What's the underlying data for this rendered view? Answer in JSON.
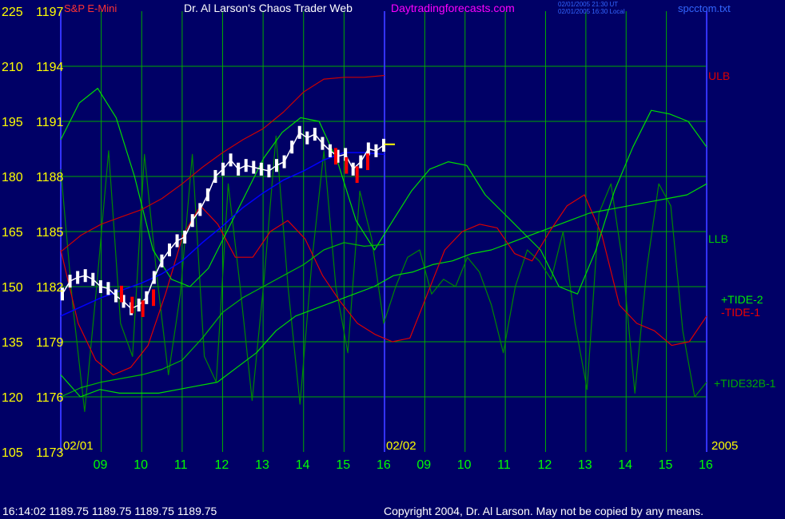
{
  "header": {
    "instrument": "S&P E-Mini",
    "title": "Dr. Al Larson's Chaos Trader Web",
    "site": "Daytradingforecasts.com",
    "stamp_line1": "02/01/2005 21:30 UT",
    "stamp_line2": "02/01/2005 16:30 Local",
    "filename": "spcctom.txt"
  },
  "footer": {
    "quote": "16:14:02  1189.75 1189.75 1189.75 1189.75",
    "copyright": "Copyright 2004, Dr. Al Larson. May not be copied by any means."
  },
  "colors": {
    "background": "#000066",
    "grid": "#00aa00",
    "axis_label": "#ffff00",
    "hour_label": "#00ff00",
    "price_bars": "#ffffff",
    "price_bars_red": "#ff0000",
    "divider": "#3333ff",
    "ulb": "#cc0000",
    "llb": "#00bb00",
    "tide2": "#00dd00",
    "tide1": "#dd0000",
    "tide32": "#008800",
    "moving_avg": "#0000ff",
    "forecast_tick": "#ffff00"
  },
  "chart_data": {
    "type": "line",
    "y_left_outer": {
      "labels": [
        "225",
        "210",
        "195",
        "180",
        "165",
        "150",
        "135",
        "120",
        "105"
      ],
      "range": [
        105,
        225
      ]
    },
    "y_left_inner": {
      "labels": [
        "1197",
        "1194",
        "1191",
        "1188",
        "1185",
        "1182",
        "1179",
        "1176",
        "1173"
      ],
      "range": [
        1173,
        1197
      ]
    },
    "x_hours": [
      "09",
      "10",
      "11",
      "12",
      "13",
      "14",
      "15",
      "16",
      "09",
      "10",
      "11",
      "12",
      "13",
      "14",
      "15",
      "16"
    ],
    "date_labels": [
      "02/01",
      "02/02"
    ],
    "year_label": "2005",
    "grid": true,
    "line_labels": {
      "ulb": "ULB",
      "llb": "LLB",
      "tide2": "+TIDE-2",
      "tide1": "-TIDE-1",
      "tide32": "+TIDE32B-1"
    },
    "price_close": [
      1181.6,
      1182.3,
      1182.5,
      1182.6,
      1182.4,
      1182.0,
      1181.9,
      1181.5,
      1181.2,
      1180.8,
      1181.0,
      1181.4,
      1182.5,
      1183.4,
      1184.0,
      1184.5,
      1184.7,
      1185.6,
      1186.2,
      1187.0,
      1188.0,
      1188.4,
      1188.9,
      1188.4,
      1188.6,
      1188.5,
      1188.4,
      1188.3,
      1188.6,
      1188.8,
      1189.6,
      1190.4,
      1190.1,
      1190.3,
      1189.8,
      1189.4,
      1189.1,
      1189.2,
      1188.4,
      1188.8,
      1189.5,
      1189.4,
      1189.7
    ],
    "price_red_segments": [
      [
        1181.6,
        1181.0,
        1180.8,
        1181.4
      ],
      [
        1189.1,
        1188.6,
        1188.1,
        1188.8
      ]
    ],
    "forecast_tick": 1189.75,
    "ulb_price": [
      1183.9,
      1184.8,
      1185.4,
      1185.8,
      1186.2,
      1186.8,
      1187.6,
      1188.5,
      1189.3,
      1190.0,
      1190.6,
      1191.5,
      1192.6,
      1193.3,
      1193.4,
      1193.4,
      1193.5
    ],
    "llb_price": [
      1176.0,
      1176.5,
      1176.8,
      1177.0,
      1177.2,
      1177.5,
      1178.0,
      1179.2,
      1180.6,
      1181.4,
      1182.0,
      1182.6,
      1183.2,
      1184.0,
      1184.4,
      1184.2,
      1184.3
    ],
    "moving_avg_price": [
      1180.4,
      1180.9,
      1181.4,
      1181.8,
      1182.2,
      1182.7,
      1183.4,
      1184.4,
      1185.3,
      1186.3,
      1187.1,
      1187.8,
      1188.3,
      1188.9,
      1189.3,
      1189.3,
      1189.2
    ],
    "tide2": [
      190,
      200,
      204,
      196,
      180,
      160,
      152,
      150,
      155,
      165,
      175,
      185,
      192,
      196,
      195,
      184,
      168,
      160,
      168,
      176,
      182,
      184,
      183,
      175,
      170,
      165,
      160,
      150,
      148,
      160,
      176,
      188,
      198,
      197,
      195,
      188
    ],
    "tide1": [
      160,
      140,
      130,
      126,
      128,
      134,
      148,
      164,
      172,
      167,
      158,
      158,
      165,
      168,
      163,
      153,
      146,
      140,
      137,
      135,
      136,
      148,
      160,
      165,
      167,
      166,
      159,
      157,
      165,
      172,
      175,
      164,
      145,
      140,
      138,
      134,
      135,
      142
    ],
    "tide32": [
      126,
      120,
      122,
      121,
      121,
      121,
      122,
      123,
      124,
      128,
      132,
      138,
      142,
      144,
      146,
      148,
      150,
      153,
      154,
      156,
      157,
      159,
      160,
      162,
      164,
      166,
      168,
      170,
      171,
      172,
      173,
      174,
      175,
      178
    ],
    "tide32b_fine": [
      182,
      145,
      116,
      150,
      187,
      140,
      131,
      186,
      154,
      126,
      148,
      186,
      131,
      124,
      178,
      150,
      119,
      152,
      191,
      150,
      118,
      157,
      187,
      150,
      132,
      176,
      163,
      140,
      150,
      158,
      160,
      148,
      152,
      150,
      158,
      154,
      145,
      132,
      150,
      160,
      157,
      152,
      165,
      140,
      122,
      170,
      178,
      156,
      121,
      155,
      178,
      172,
      138,
      120,
      124
    ]
  }
}
